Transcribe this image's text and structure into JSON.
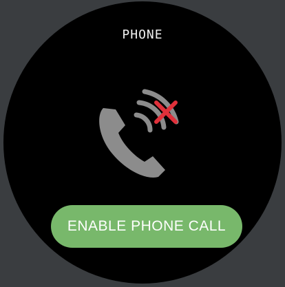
{
  "app": {
    "title": "PHONE"
  },
  "status": {
    "icon": "phone-disabled-icon",
    "accent_color": "#e0303a",
    "icon_color": "#8c8c8c"
  },
  "actions": {
    "enable_label": "ENABLE PHONE CALL",
    "button_color": "#78b86b"
  }
}
